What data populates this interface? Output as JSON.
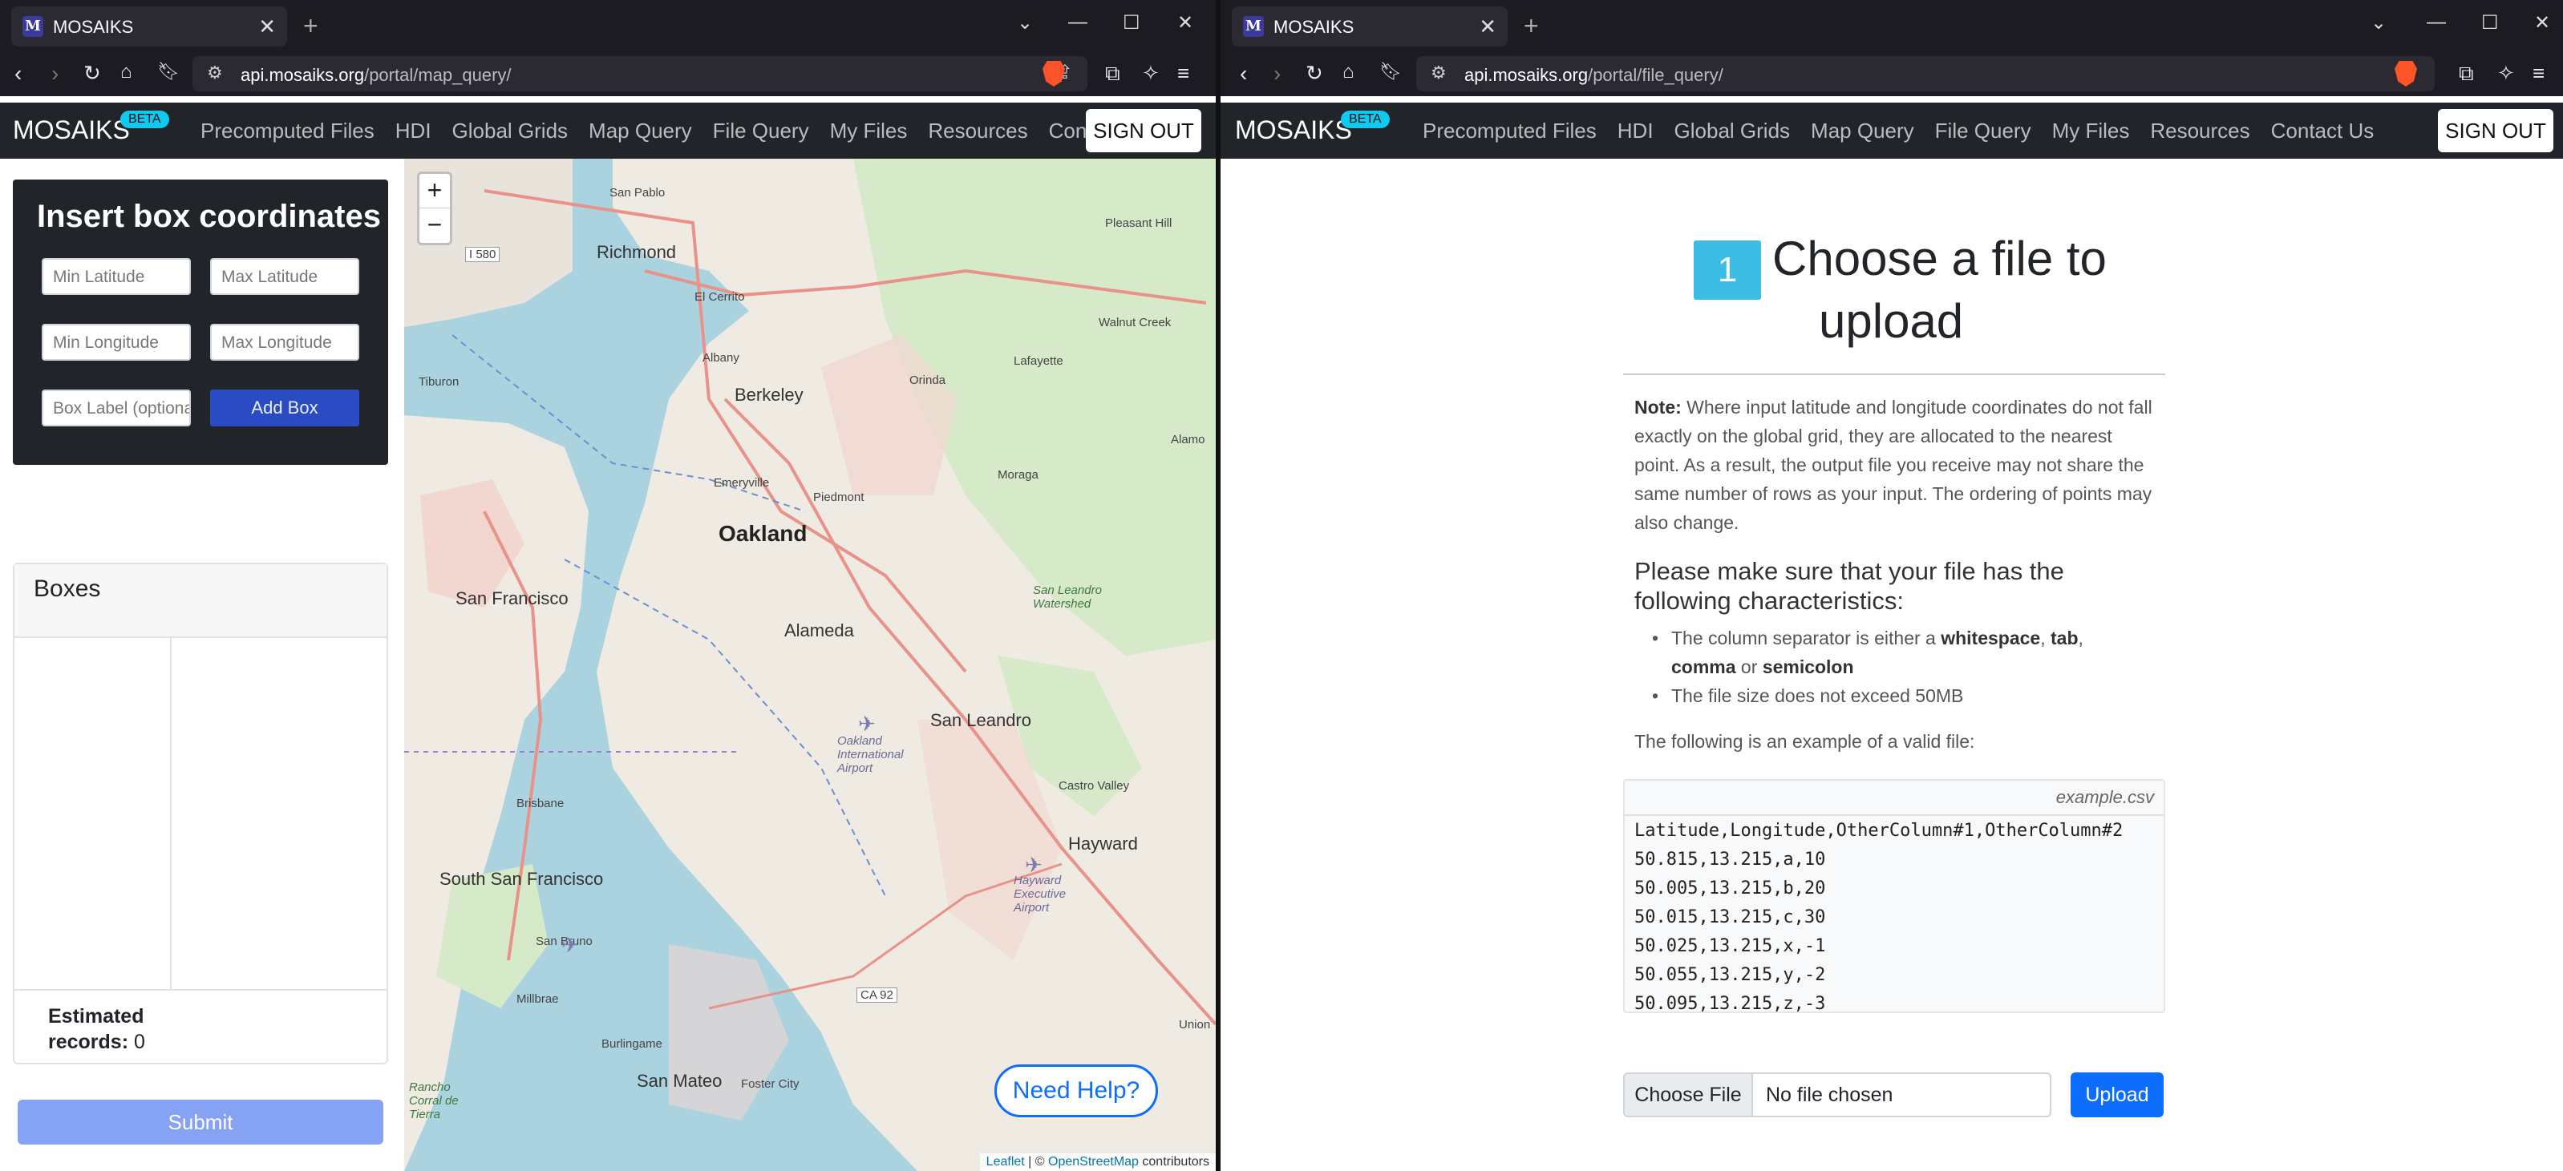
{
  "left": {
    "tab_title": "MOSAIKS",
    "url_host": "api.mosaiks.org",
    "url_path": "/portal/map_query/",
    "brand": "MOSAIKS",
    "beta": "BETA",
    "nav": [
      "Precomputed Files",
      "HDI",
      "Global Grids",
      "Map Query",
      "File Query",
      "My Files",
      "Resources",
      "Contact Us"
    ],
    "sign_out": "SIGN OUT",
    "panel_title": "Insert box coordinates",
    "min_lat": "Min Latitude",
    "max_lat": "Max Latitude",
    "min_lon": "Min Longitude",
    "max_lon": "Max Longitude",
    "box_label": "Box Label (optional)",
    "add_box": "Add Box",
    "boxes_title": "Boxes",
    "est_label": "Estimated",
    "est_label2": "records:",
    "est_value": "0",
    "submit": "Submit",
    "need_help": "Need Help?",
    "attr_leaflet": "Leaflet",
    "attr_sep": " | © ",
    "attr_osm": "OpenStreetMap",
    "attr_contrib": " contributors",
    "map_labels": {
      "oakland": "Oakland",
      "san_francisco": "San Francisco",
      "berkeley": "Berkeley",
      "alameda": "Alameda",
      "richmond": "Richmond",
      "san_leandro": "San Leandro",
      "hayward": "Hayward",
      "south_sf": "South San Francisco",
      "san_mateo": "San Mateo",
      "brisbane": "Brisbane",
      "san_pablo": "San Pablo",
      "el_cerrito": "El Cerrito",
      "albany": "Albany",
      "emeryville": "Emeryville",
      "piedmont": "Piedmont",
      "orinda": "Orinda",
      "lafayette": "Lafayette",
      "moraga": "Moraga",
      "castro_valley": "Castro Valley",
      "tiburon": "Tiburon",
      "san_bruno": "San Bruno",
      "millbrae": "Millbrae",
      "burlingame": "Burlingame",
      "foster_city": "Foster City",
      "walnut_creek": "Walnut Creek",
      "pleasant_hill": "Pleasant Hill",
      "alamo": "Alamo",
      "union_city": "Union",
      "i580": "I 580",
      "ca92": "CA 92",
      "oakland_airport": "Oakland International Airport",
      "hayward_airport": "Hayward Executive Airport",
      "san_leandro_watershed": "San Leandro Watershed",
      "rancho": "Rancho Corral de Tierra"
    }
  },
  "right": {
    "tab_title": "MOSAIKS",
    "url_host": "api.mosaiks.org",
    "url_path": "/portal/file_query/",
    "brand": "MOSAIKS",
    "beta": "BETA",
    "nav": [
      "Precomputed Files",
      "HDI",
      "Global Grids",
      "Map Query",
      "File Query",
      "My Files",
      "Resources",
      "Contact Us"
    ],
    "sign_out": "SIGN OUT",
    "step": "1",
    "heading1": "Choose a file to",
    "heading2": "upload",
    "note_label": "Note:",
    "note_text": " Where input latitude and longitude coordinates do not fall exactly on the global grid, they are allocated to the nearest point. As a result, the output file you receive may not share the same number of rows as your input. The ordering of points may also change.",
    "req_heading": "Please make sure that your file has the following characteristics:",
    "bullet1_pre": "The column separator is either a ",
    "bullet1_ws": "whitespace",
    "bullet1_sep": ", ",
    "bullet1_tab": "tab",
    "bullet1_comma": "comma",
    "bullet1_or": " or ",
    "bullet1_semi": "semicolon",
    "bullet2": "The file size does not exceed 50MB",
    "example_intro": "The following is an example of a valid file:",
    "example_name": "example.csv",
    "code_lines": [
      "Latitude,Longitude,OtherColumn#1,OtherColumn#2",
      "50.815,13.215,a,10",
      "50.005,13.215,b,20",
      "50.015,13.215,c,30",
      "50.025,13.215,x,-1",
      "50.055,13.215,y,-2",
      "50.095,13.215,z,-3"
    ],
    "choose_file": "Choose File",
    "no_file": "No file chosen",
    "upload": "Upload"
  }
}
